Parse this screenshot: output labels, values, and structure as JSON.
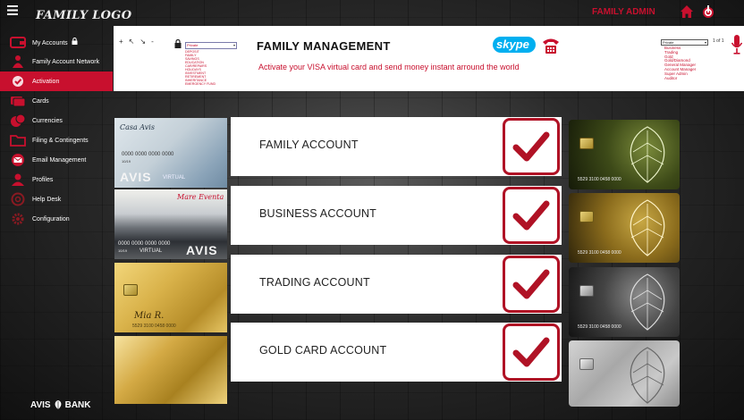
{
  "app": {
    "logo": "FAMILY LOGO",
    "admin_label": "FAMILY ADMIN",
    "bank_logo_left": "AVIS",
    "bank_logo_right": "BANK"
  },
  "colors": {
    "accent": "#c8102e",
    "sidebar_active": "#c8102e",
    "check_border": "#b01225"
  },
  "sidebar": {
    "items": [
      {
        "label": "My Accounts",
        "icon": "wallet-icon",
        "active": false,
        "locked": true
      },
      {
        "label": "Family Account Network",
        "icon": "family-network-icon",
        "active": false
      },
      {
        "label": "Activation",
        "icon": "activation-icon",
        "active": true
      },
      {
        "label": "Cards",
        "icon": "cards-icon",
        "active": false
      },
      {
        "label": "Currencies",
        "icon": "currencies-icon",
        "active": false
      },
      {
        "label": "Filing & Contingents",
        "icon": "folder-icon",
        "active": false
      },
      {
        "label": "Email Management",
        "icon": "email-icon",
        "active": false
      },
      {
        "label": "Profiles",
        "icon": "profile-icon",
        "active": false
      },
      {
        "label": "Help Desk",
        "icon": "help-icon",
        "active": false
      },
      {
        "label": "Configuration",
        "icon": "gear-icon",
        "active": false
      }
    ]
  },
  "header": {
    "toolbar": [
      "+",
      "↖",
      "↘",
      "-"
    ],
    "select_value": "Private",
    "select_options": [
      "DEPOSIT",
      "FAMILY",
      "SAVINGS",
      "EDUCATION",
      "CAR/REPAIRS",
      "HOLIDAYS",
      "INVESTMENT",
      "RETIREMENT",
      "INHERITANCE",
      "EMERGENCY FUND"
    ],
    "title": "FAMILY MANAGEMENT",
    "subtitle": "Activate your VISA virtual card and send money instant arround the world",
    "skype_label": "skype",
    "right_select_value": "Private",
    "right_page": "1 of 1",
    "right_options": [
      "Business",
      "Trading",
      "Gold",
      "Gold/Diamond",
      "General Manager",
      "Account Manager",
      "Super Admin",
      "Auditor"
    ]
  },
  "accounts": [
    {
      "label": "FAMILY ACCOUNT",
      "checked": true
    },
    {
      "label": "BUSINESS ACCOUNT",
      "checked": true
    },
    {
      "label": "TRADING ACCOUNT",
      "checked": true
    },
    {
      "label": "GOLD CARD ACCOUNT",
      "checked": true
    }
  ],
  "left_cards": [
    {
      "name": "Casa Avis",
      "number": "0000 0000 0000 0000",
      "date": "10/19",
      "brand": "AVIS",
      "type": "VIRTUAL"
    },
    {
      "name": "Mare Eventa",
      "number": "0000 0000 0000 0000",
      "date": "10/19",
      "brand": "AVIS",
      "type": "VIRTUAL"
    },
    {
      "name": "Mia R.",
      "number": "5529 3100 0458 0000"
    },
    {
      "name": ""
    }
  ],
  "right_cards": [
    {
      "number": "5529 3100 0458 0000"
    },
    {
      "number": "5529 3100 0458 0000"
    },
    {
      "number": "5529 3100 0458 0000"
    },
    {
      "number": ""
    }
  ]
}
